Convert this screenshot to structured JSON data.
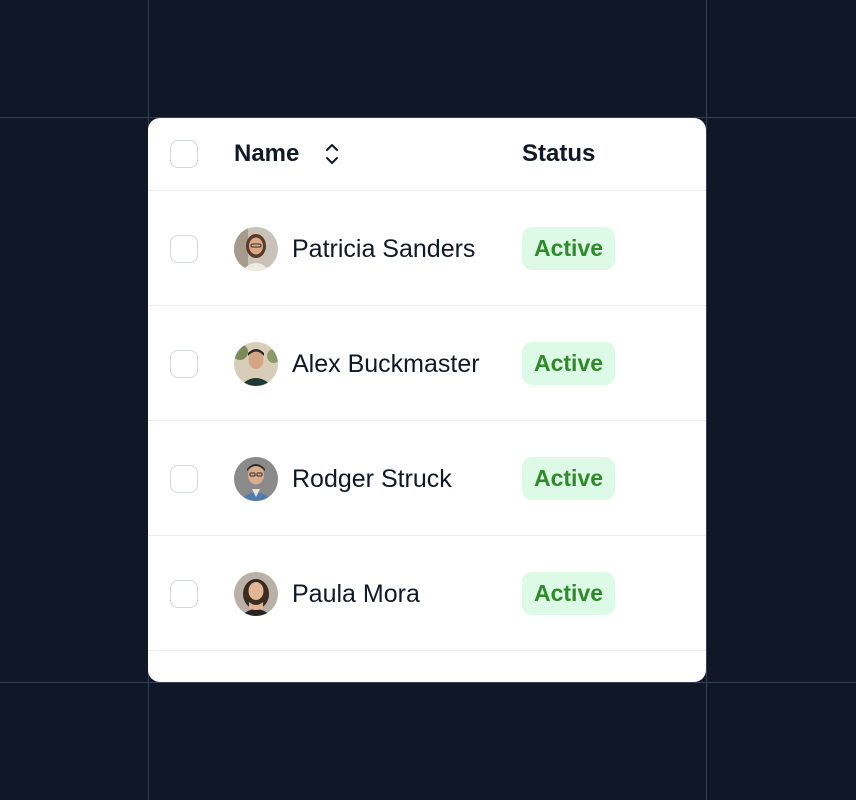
{
  "table": {
    "headers": {
      "name": "Name",
      "status": "Status"
    },
    "rows": [
      {
        "name": "Patricia Sanders",
        "status": "Active"
      },
      {
        "name": "Alex Buckmaster",
        "status": "Active"
      },
      {
        "name": "Rodger Struck",
        "status": "Active"
      },
      {
        "name": "Paula Mora",
        "status": "Active"
      }
    ]
  },
  "icons": {
    "sort": "chevron-up-down-icon",
    "avatar": "user-avatar"
  },
  "colors": {
    "background": "#101828",
    "card": "#ffffff",
    "badge_bg": "#dcfae6",
    "badge_text": "#2f8a2a",
    "divider": "#eaecf0"
  }
}
